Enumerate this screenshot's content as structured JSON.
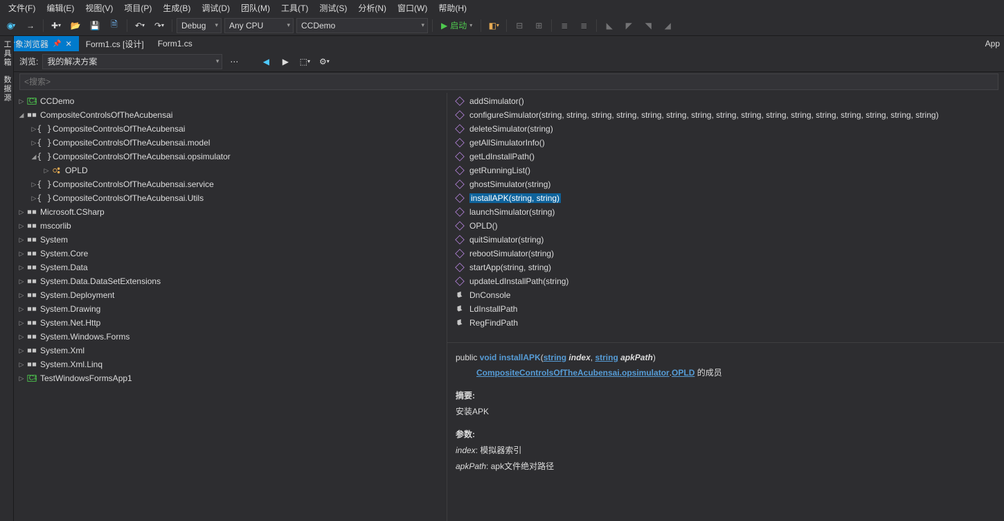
{
  "menu": [
    "文件(F)",
    "编辑(E)",
    "视图(V)",
    "项目(P)",
    "生成(B)",
    "调试(D)",
    "团队(M)",
    "工具(T)",
    "测试(S)",
    "分析(N)",
    "窗口(W)",
    "帮助(H)"
  ],
  "toolbar": {
    "config": "Debug",
    "platform": "Any CPU",
    "project": "CCDemo",
    "start": "启动"
  },
  "tabs": {
    "active": "对象浏览器",
    "others": [
      "Form1.cs [设计]",
      "Form1.cs"
    ],
    "right": "App"
  },
  "sidetabs": [
    "工具箱",
    "数据源"
  ],
  "browser": {
    "browse_label": "浏览:",
    "scope": "我的解决方案",
    "search_placeholder": "<搜索>"
  },
  "tree": [
    {
      "d": 0,
      "a": "r",
      "i": "cs",
      "t": "CCDemo"
    },
    {
      "d": 0,
      "a": "d",
      "i": "asm",
      "t": "CompositeControlsOfTheAcubensai"
    },
    {
      "d": 1,
      "a": "r",
      "i": "ns",
      "t": "CompositeControlsOfTheAcubensai"
    },
    {
      "d": 1,
      "a": "r",
      "i": "ns",
      "t": "CompositeControlsOfTheAcubensai.model"
    },
    {
      "d": 1,
      "a": "d",
      "i": "ns",
      "t": "CompositeControlsOfTheAcubensai.opsimulator"
    },
    {
      "d": 2,
      "a": "r",
      "i": "cls",
      "t": "OPLD"
    },
    {
      "d": 1,
      "a": "r",
      "i": "ns",
      "t": "CompositeControlsOfTheAcubensai.service"
    },
    {
      "d": 1,
      "a": "r",
      "i": "ns",
      "t": "CompositeControlsOfTheAcubensai.Utils"
    },
    {
      "d": 0,
      "a": "r",
      "i": "asm",
      "t": "Microsoft.CSharp"
    },
    {
      "d": 0,
      "a": "r",
      "i": "asm",
      "t": "mscorlib"
    },
    {
      "d": 0,
      "a": "r",
      "i": "asm",
      "t": "System"
    },
    {
      "d": 0,
      "a": "r",
      "i": "asm",
      "t": "System.Core"
    },
    {
      "d": 0,
      "a": "r",
      "i": "asm",
      "t": "System.Data"
    },
    {
      "d": 0,
      "a": "r",
      "i": "asm",
      "t": "System.Data.DataSetExtensions"
    },
    {
      "d": 0,
      "a": "r",
      "i": "asm",
      "t": "System.Deployment"
    },
    {
      "d": 0,
      "a": "r",
      "i": "asm",
      "t": "System.Drawing"
    },
    {
      "d": 0,
      "a": "r",
      "i": "asm",
      "t": "System.Net.Http"
    },
    {
      "d": 0,
      "a": "r",
      "i": "asm",
      "t": "System.Windows.Forms"
    },
    {
      "d": 0,
      "a": "r",
      "i": "asm",
      "t": "System.Xml"
    },
    {
      "d": 0,
      "a": "r",
      "i": "asm",
      "t": "System.Xml.Linq"
    },
    {
      "d": 0,
      "a": "r",
      "i": "cs",
      "t": "TestWindowsFormsApp1"
    }
  ],
  "members": [
    {
      "i": "m",
      "t": "addSimulator()"
    },
    {
      "i": "m",
      "t": "configureSimulator(string, string, string, string, string, string, string, string, string, string, string, string, string, string, string, string)"
    },
    {
      "i": "m",
      "t": "deleteSimulator(string)"
    },
    {
      "i": "m",
      "t": "getAllSimulatorInfo()"
    },
    {
      "i": "m",
      "t": "getLdInstallPath()"
    },
    {
      "i": "m",
      "t": "getRunningList()"
    },
    {
      "i": "m",
      "t": "ghostSimulator(string)"
    },
    {
      "i": "m",
      "t": "installAPK(string, string)",
      "sel": true
    },
    {
      "i": "m",
      "t": "launchSimulator(string)"
    },
    {
      "i": "m",
      "t": "OPLD()"
    },
    {
      "i": "m",
      "t": "quitSimulator(string)"
    },
    {
      "i": "m",
      "t": "rebootSimulator(string)"
    },
    {
      "i": "m",
      "t": "startApp(string, string)"
    },
    {
      "i": "m",
      "t": "updateLdInstallPath(string)"
    },
    {
      "i": "f",
      "t": "DnConsole"
    },
    {
      "i": "f",
      "t": "LdInstallPath"
    },
    {
      "i": "f",
      "t": "RegFindPath"
    }
  ],
  "detail": {
    "access": "public",
    "ret": "void",
    "name": "installAPK",
    "p1t": "string",
    "p1n": "index",
    "p2t": "string",
    "p2n": "apkPath",
    "owner_ns": "CompositeControlsOfTheAcubensai.opsimulator",
    "owner_cls": "OPLD",
    "owner_suffix": " 的成员",
    "summary_h": "摘要:",
    "summary": "安装APK",
    "params_h": "参数:",
    "param1": "模拟器索引",
    "param2": "apk文件绝对路径"
  }
}
